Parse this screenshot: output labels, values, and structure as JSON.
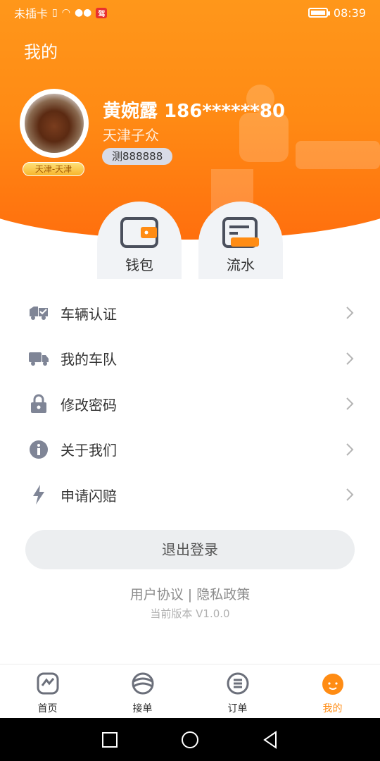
{
  "statusbar": {
    "carrier": "未插卡",
    "time": "08:39",
    "app_badge": "驾"
  },
  "header": {
    "title": "我的"
  },
  "profile": {
    "name_line": "黄婉露 186******80",
    "company": "天津子众",
    "plate": "测888888",
    "city": "天津-天津"
  },
  "quick": {
    "wallet_label": "钱包",
    "flow_label": "流水"
  },
  "menu": {
    "items": [
      {
        "label": "车辆认证",
        "icon": "truck-check-icon"
      },
      {
        "label": "我的车队",
        "icon": "truck-icon"
      },
      {
        "label": "修改密码",
        "icon": "lock-icon"
      },
      {
        "label": "关于我们",
        "icon": "info-icon"
      },
      {
        "label": "申请闪赔",
        "icon": "lightning-icon"
      }
    ]
  },
  "actions": {
    "logout": "退出登录",
    "links": "用户协议 | 隐私政策",
    "version": "当前版本 V1.0.0"
  },
  "tabs": [
    {
      "label": "首页",
      "icon": "home-icon"
    },
    {
      "label": "接单",
      "icon": "orders-wave-icon"
    },
    {
      "label": "订单",
      "icon": "list-icon"
    },
    {
      "label": "我的",
      "icon": "profile-icon",
      "active": true
    }
  ],
  "colors": {
    "accent": "#ff8c14",
    "icon_gray": "#7f8596"
  }
}
